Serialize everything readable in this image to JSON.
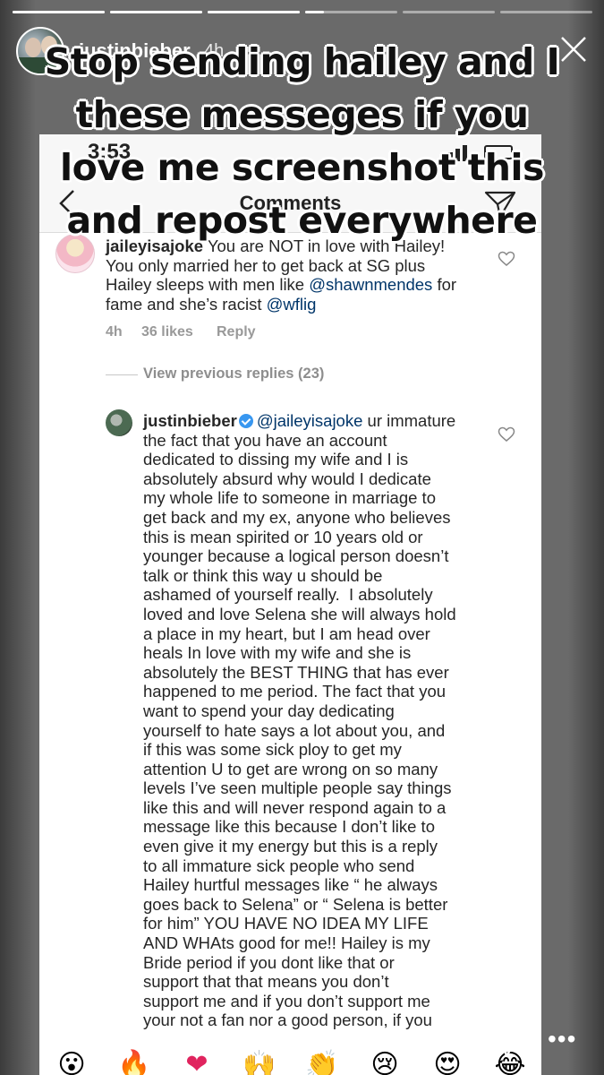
{
  "story": {
    "username": "justinbieber",
    "time": "4h",
    "progress": [
      1,
      1,
      1,
      0.2,
      0,
      0
    ],
    "caption": [
      "Stop sending hailey and I",
      "these messeges if you",
      "love me screenshot this",
      "and repost everywhere"
    ]
  },
  "screenshot": {
    "status_time": "3:53",
    "title": "Comments"
  },
  "comment1": {
    "username": "jaileyisajoke",
    "lines": [
      " You are NOT in love with Hailey!",
      "You only married her to get back at SG plus",
      "Hailey sleeps with men like ",
      " for",
      "fame and she’s racist "
    ],
    "mention1": "@shawnmendes",
    "mention2": "@wflig",
    "time": "4h",
    "likes": "36 likes",
    "reply": "Reply"
  },
  "view_previous": "View previous replies (23)",
  "comment2": {
    "username": "justinbieber",
    "mention": "@jaileyisajoke",
    "first_line_rest": " ur immature",
    "body": "the fact that you have an account\ndedicated to dissing my wife and I is\nabsolutely absurd why would I dedicate\nmy whole life to someone in marriage to\nget back and my ex, anyone who believes\nthis is mean spirited or 10 years old or\nyounger because a logical person doesn’t\ntalk or think this way u should be\nashamed of yourself really.  I absolutely\nloved and love Selena she will always hold\na place in my heart, but I am head over\nheals In love with my wife and she is\nabsolutely the BEST THING that has ever\nhappened to me period. The fact that you\nwant to spend your day dedicating\nyourself to hate says a lot about you, and\nif this was some sick ploy to get my\nattention U to get are wrong on so many\nlevels I’ve seen multiple people say things\nlike this and will never respond again to a\nmessage like this because I don’t like to\neven give it my energy but this is a reply\nto all immature sick people who send\nHailey hurtful messages like “ he always\ngoes back to Selena” or “ Selena is better\nfor him” YOU HAVE NO IDEA MY LIFE\nAND WHAts good for me!! Hailey is my\nBride period if you dont like that or\nsupport that that means you don’t\nsupport me and if you don’t support me\nyour not a fan nor a good person, if you"
  },
  "reactions": [
    "😮",
    "🔥",
    "❤",
    "🙌",
    "👏",
    "😢",
    "😍",
    "😂"
  ],
  "more": "•••",
  "icons": {
    "close": "close-icon",
    "back": "chevron-left-icon",
    "send": "direct-message-icon",
    "heart": "heart-icon",
    "verified": "verified-badge-icon"
  },
  "colors": {
    "mention": "#003569",
    "verified": "#3897f0",
    "meta": "#999999"
  }
}
